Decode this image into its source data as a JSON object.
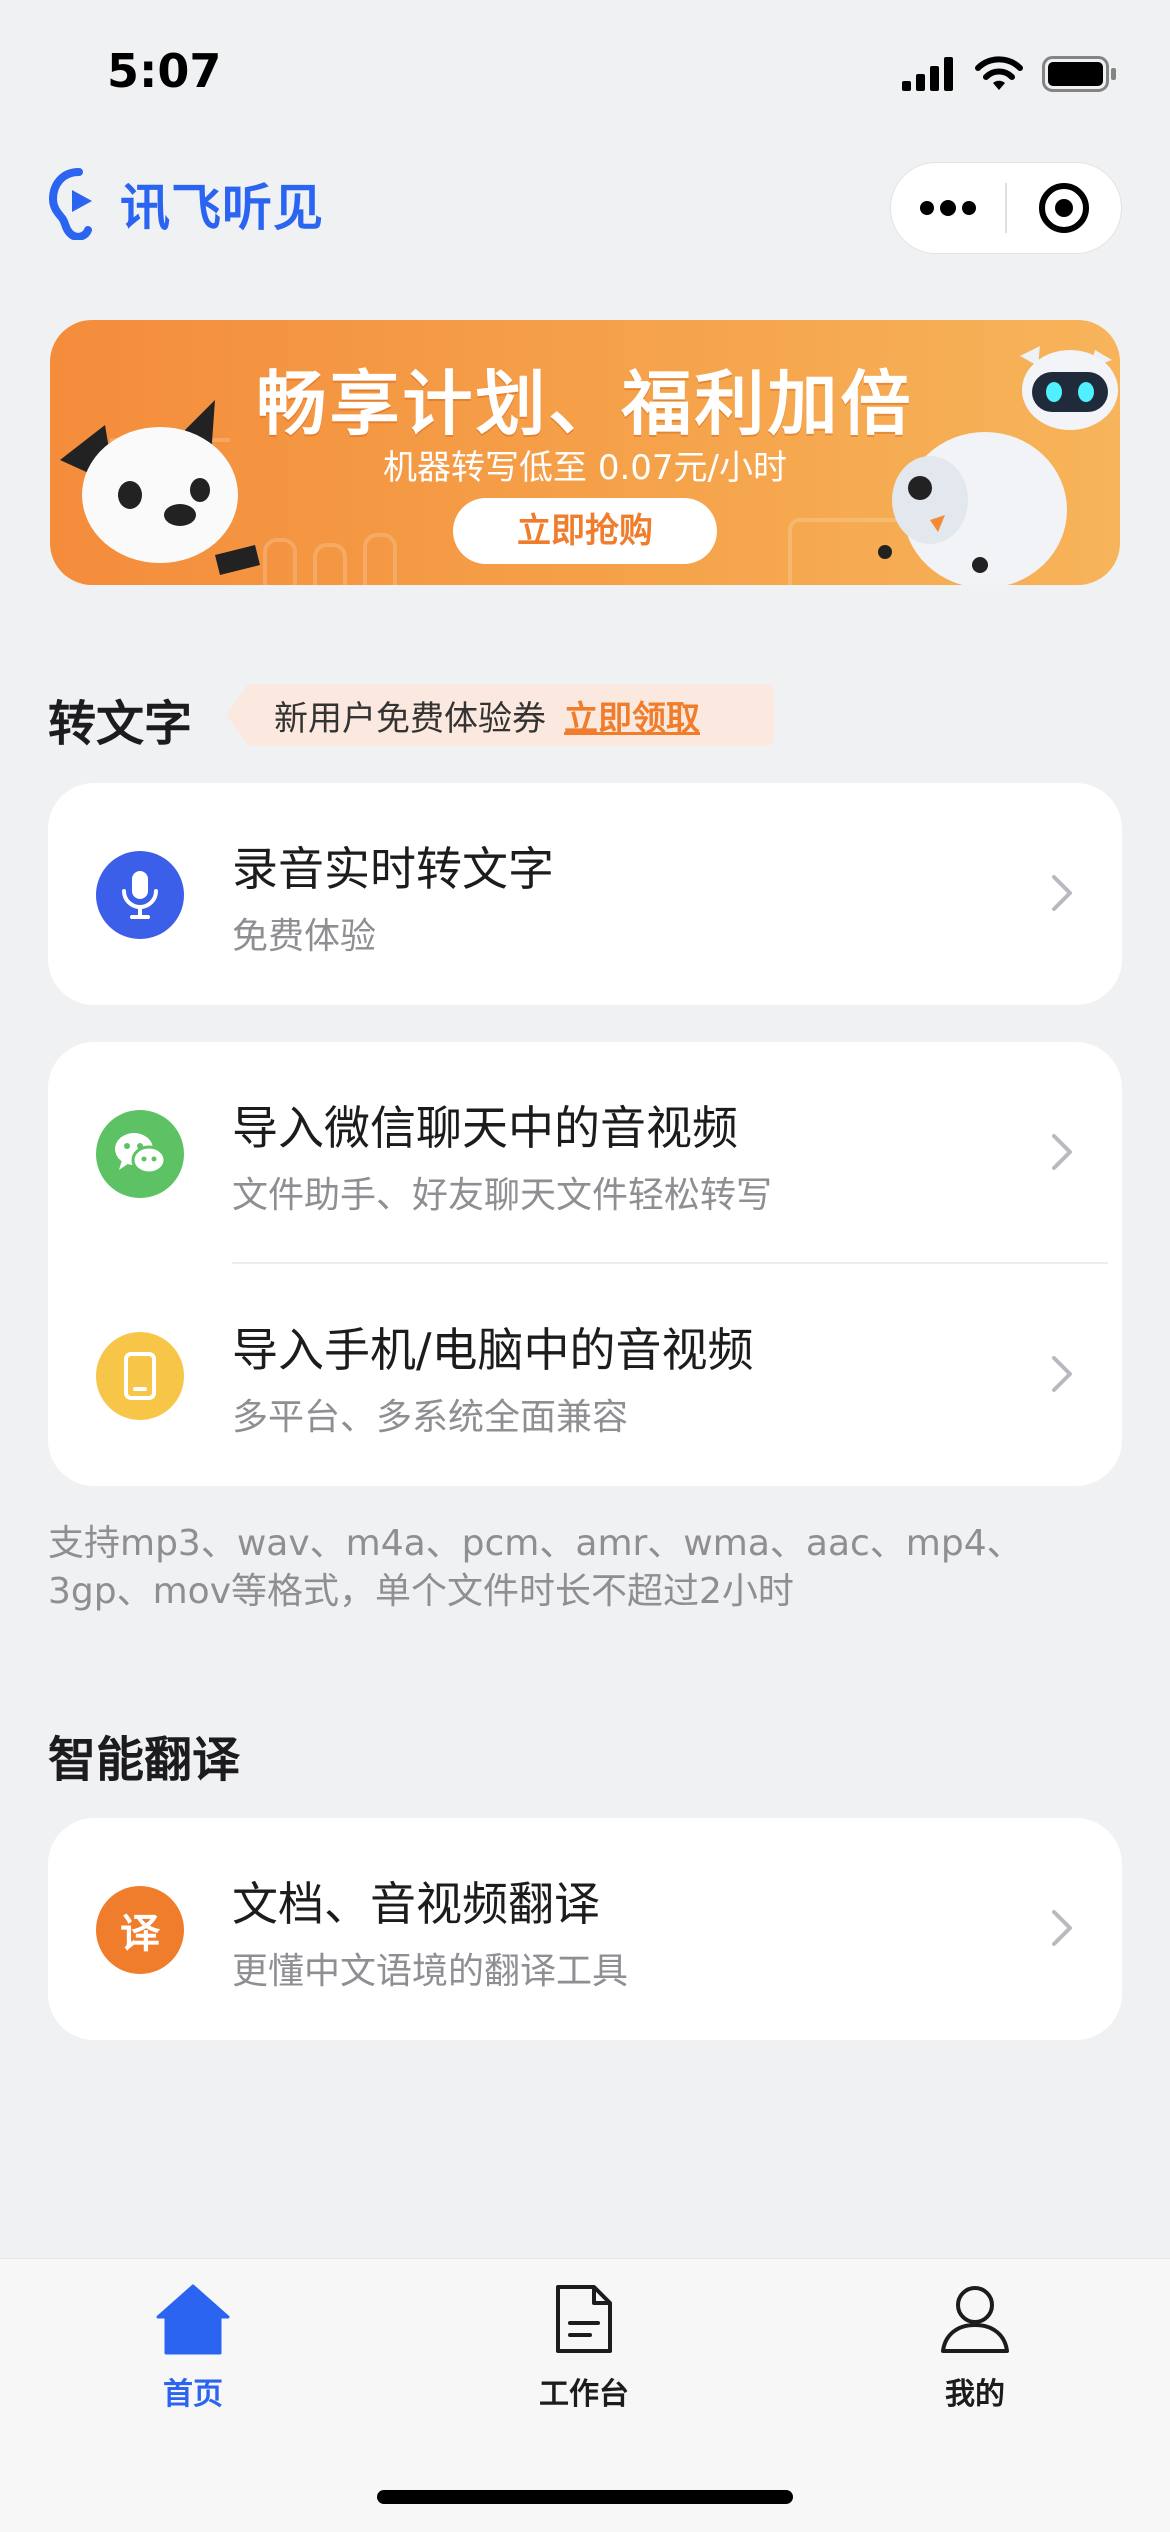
{
  "status_bar": {
    "time": "5:07"
  },
  "header": {
    "logo_text": "讯飞听见",
    "more_icon": "more-dots-icon",
    "target_icon": "target-icon"
  },
  "banner": {
    "title": "畅享计划、福利加倍",
    "subtitle": "机器转写低至 0.07元/小时",
    "button": "立即抢购"
  },
  "transcribe": {
    "title": "转文字",
    "coupon_text": "新用户免费体验券",
    "coupon_link": "立即领取",
    "items": [
      {
        "title": "录音实时转文字",
        "subtitle": "免费体验",
        "icon": "microphone-icon",
        "color": "#3b5fe8"
      },
      {
        "title": "导入微信聊天中的音视频",
        "subtitle": "文件助手、好友聊天文件轻松转写",
        "icon": "wechat-icon",
        "color": "#5cc264"
      },
      {
        "title": "导入手机/电脑中的音视频",
        "subtitle": "多平台、多系统全面兼容",
        "icon": "phone-icon",
        "color": "#f7c548"
      }
    ],
    "note": "支持mp3、wav、m4a、pcm、amr、wma、aac、mp4、3gp、mov等格式，单个文件时长不超过2小时"
  },
  "translate": {
    "title": "智能翻译",
    "items": [
      {
        "title": "文档、音视频翻译",
        "subtitle": "更懂中文语境的翻译工具",
        "icon": "translate-icon",
        "icon_text": "译",
        "color": "#ef7d2c"
      }
    ]
  },
  "tabbar": {
    "tabs": [
      {
        "label": "首页",
        "active": true
      },
      {
        "label": "工作台",
        "active": false
      },
      {
        "label": "我的",
        "active": false
      }
    ]
  },
  "colors": {
    "accent": "#2b64f0",
    "orange": "#ef7d2c"
  }
}
